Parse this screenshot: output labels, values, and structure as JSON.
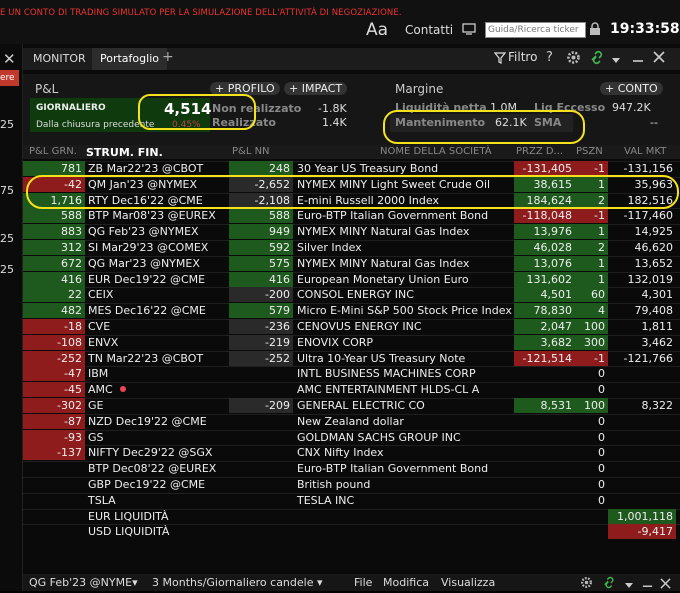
{
  "topbar": {
    "sim_banner": "E UN CONTO DI TRADING SIMULATO PER LA SIMULAZIONE DELL'ATTIVITÀ DI NEGOZIAZIONE.",
    "aa": "Aa",
    "contacts": "Contatti",
    "search_placeholder": "Guida/Ricerca ticker",
    "clock": "19:33:58"
  },
  "left_strip": {
    "close": "✕",
    "ere": "ere",
    "numbers": [
      "25",
      "75",
      "25",
      "25"
    ]
  },
  "tabs": {
    "monitor": "MONITOR",
    "portfolio": "Portafoglio",
    "add": "+",
    "filter": "Filtro",
    "help": "?"
  },
  "pnl": {
    "title": "P&L",
    "btn_profile": "PROFILO",
    "btn_impact": "IMPACT",
    "daily_label": "GIORNALIERO",
    "daily_value": "4,514",
    "since_close_label": "Dalla chiusura precedente",
    "since_close_pct": "0.45%",
    "unrealized_label": "Non realizzato",
    "unrealized_value": "-1.8K",
    "realized_label": "Realizzato",
    "realized_value": "1.4K"
  },
  "margin": {
    "title": "Margine",
    "btn_account": "CONTO",
    "net_liq_label": "Liquidità netta",
    "net_liq_value": "1.0M",
    "excess_label": "Liq Eccesso",
    "excess_value": "947.2K",
    "maint_label": "Mantenimento",
    "maint_value": "62.1K",
    "sma_label": "SMA",
    "sma_value": "--"
  },
  "table": {
    "headers": {
      "pnl_day": "P&L GRN.",
      "instrument": "STRUM. FIN.",
      "pnl_nn": "P&L NN",
      "company": "NOME DELLA SOCIETÀ",
      "avg_price": "PRZZ D...",
      "position": "PSZN",
      "mkt_value": "VAL MKT"
    },
    "rows": [
      {
        "pnl": "781",
        "sym": "ZB Mar22'23 @CBOT",
        "nn": "248",
        "name": "30 Year US Treasury Bond",
        "price": "-131,405",
        "pos": "-1",
        "val": "-131,156",
        "pnlc": "dg",
        "nnc": "dg",
        "pricec": "red",
        "valc": ""
      },
      {
        "pnl": "-42",
        "sym": "QM Jan'23 @NYMEX",
        "nn": "-2,652",
        "name": "NYMEX MINY Light Sweet Crude Oil",
        "price": "38,615",
        "pos": "1",
        "val": "35,963",
        "pnlc": "red",
        "nnc": "gray",
        "pricec": "dg",
        "valc": ""
      },
      {
        "pnl": "1,716",
        "sym": "RTY Dec16'22 @CME",
        "nn": "-2,108",
        "name": "E-mini Russell 2000 Index",
        "price": "184,624",
        "pos": "2",
        "val": "182,516",
        "pnlc": "dg",
        "nnc": "gray",
        "pricec": "dg",
        "valc": ""
      },
      {
        "pnl": "588",
        "sym": "BTP Mar08'23 @EUREX",
        "nn": "588",
        "name": "Euro-BTP Italian Government Bond",
        "price": "-118,048",
        "pos": "-1",
        "val": "-117,460",
        "pnlc": "dg",
        "nnc": "dg",
        "pricec": "red",
        "valc": ""
      },
      {
        "pnl": "883",
        "sym": "QG Feb'23 @NYMEX",
        "nn": "949",
        "name": "NYMEX MINY Natural Gas Index",
        "price": "13,976",
        "pos": "1",
        "val": "14,925",
        "pnlc": "dg",
        "nnc": "dg",
        "pricec": "dg",
        "valc": ""
      },
      {
        "pnl": "312",
        "sym": "SI Mar29'23 @COMEX",
        "nn": "592",
        "name": "Silver Index",
        "price": "46,028",
        "pos": "2",
        "val": "46,620",
        "pnlc": "dg",
        "nnc": "dg",
        "pricec": "dg",
        "valc": ""
      },
      {
        "pnl": "672",
        "sym": "QG Mar'23 @NYMEX",
        "nn": "575",
        "name": "NYMEX MINY Natural Gas Index",
        "price": "13,076",
        "pos": "1",
        "val": "13,652",
        "pnlc": "dg",
        "nnc": "dg",
        "pricec": "dg",
        "valc": ""
      },
      {
        "pnl": "416",
        "sym": "EUR Dec19'22 @CME",
        "nn": "416",
        "name": "European Monetary Union Euro",
        "price": "131,602",
        "pos": "1",
        "val": "132,019",
        "pnlc": "dg",
        "nnc": "dg",
        "pricec": "dg",
        "valc": ""
      },
      {
        "pnl": "22",
        "sym": "CEIX",
        "nn": "-200",
        "name": "CONSOL ENERGY INC",
        "price": "4,501",
        "pos": "60",
        "val": "4,301",
        "pnlc": "dg",
        "nnc": "gray",
        "pricec": "dg",
        "valc": ""
      },
      {
        "pnl": "482",
        "sym": "MES Dec16'22 @CME",
        "nn": "579",
        "name": "Micro E-Mini S&P 500 Stock Price Index",
        "price": "78,830",
        "pos": "4",
        "val": "79,408",
        "pnlc": "dg",
        "nnc": "dg",
        "pricec": "dg",
        "valc": ""
      },
      {
        "pnl": "-18",
        "sym": "CVE",
        "nn": "-236",
        "name": "CENOVUS ENERGY INC",
        "price": "2,047",
        "pos": "100",
        "val": "1,811",
        "pnlc": "red",
        "nnc": "gray",
        "pricec": "dg",
        "valc": ""
      },
      {
        "pnl": "-108",
        "sym": "ENVX",
        "nn": "-219",
        "name": "ENOVIX CORP",
        "price": "3,682",
        "pos": "300",
        "val": "3,462",
        "pnlc": "red",
        "nnc": "gray",
        "pricec": "dg",
        "valc": ""
      },
      {
        "pnl": "-252",
        "sym": "TN Mar22'23 @CBOT",
        "nn": "-252",
        "name": "Ultra 10-Year US Treasury Note",
        "price": "-121,514",
        "pos": "-1",
        "val": "-121,766",
        "pnlc": "red",
        "nnc": "gray",
        "pricec": "red",
        "valc": ""
      },
      {
        "pnl": "-47",
        "sym": "IBM",
        "nn": "",
        "name": "INTL BUSINESS MACHINES CORP",
        "price": "",
        "pos": "0",
        "val": "",
        "pnlc": "red",
        "nnc": "",
        "pricec": "",
        "valc": ""
      },
      {
        "pnl": "-45",
        "sym": "AMC",
        "nn": "",
        "name": "AMC ENTERTAINMENT HLDS-CL A",
        "price": "",
        "pos": "0",
        "val": "",
        "pnlc": "red",
        "nnc": "",
        "pricec": "",
        "valc": "",
        "dot": true
      },
      {
        "pnl": "-302",
        "sym": "GE",
        "nn": "-209",
        "name": "GENERAL ELECTRIC CO",
        "price": "8,531",
        "pos": "100",
        "val": "8,322",
        "pnlc": "red",
        "nnc": "gray",
        "pricec": "dg",
        "valc": ""
      },
      {
        "pnl": "-87",
        "sym": "NZD Dec19'22 @CME",
        "nn": "",
        "name": "New Zealand dollar",
        "price": "",
        "pos": "0",
        "val": "",
        "pnlc": "red",
        "nnc": "",
        "pricec": "",
        "valc": ""
      },
      {
        "pnl": "-93",
        "sym": "GS",
        "nn": "",
        "name": "GOLDMAN SACHS GROUP INC",
        "price": "",
        "pos": "0",
        "val": "",
        "pnlc": "red",
        "nnc": "",
        "pricec": "",
        "valc": ""
      },
      {
        "pnl": "-137",
        "sym": "NIFTY Dec29'22 @SGX",
        "nn": "",
        "name": "CNX Nifty Index",
        "price": "",
        "pos": "0",
        "val": "",
        "pnlc": "red",
        "nnc": "",
        "pricec": "",
        "valc": ""
      },
      {
        "pnl": "",
        "sym": "BTP Dec08'22 @EUREX",
        "nn": "",
        "name": "Euro-BTP Italian Government Bond",
        "price": "",
        "pos": "0",
        "val": "",
        "pnlc": "",
        "nnc": "",
        "pricec": "",
        "valc": ""
      },
      {
        "pnl": "",
        "sym": "GBP Dec19'22 @CME",
        "nn": "",
        "name": "British pound",
        "price": "",
        "pos": "0",
        "val": "",
        "pnlc": "",
        "nnc": "",
        "pricec": "",
        "valc": ""
      },
      {
        "pnl": "",
        "sym": "TSLA",
        "nn": "",
        "name": "TESLA INC",
        "price": "",
        "pos": "0",
        "val": "",
        "pnlc": "",
        "nnc": "",
        "pricec": "",
        "valc": ""
      },
      {
        "pnl": "",
        "sym": "EUR LIQUIDITÀ",
        "nn": "",
        "name": "",
        "price": "",
        "pos": "",
        "val": "1,001,118",
        "pnlc": "",
        "nnc": "",
        "pricec": "",
        "valc": "dg"
      },
      {
        "pnl": "",
        "sym": "USD LIQUIDITÀ",
        "nn": "",
        "name": "",
        "price": "",
        "pos": "",
        "val": "-9,417",
        "pnlc": "",
        "nnc": "",
        "pricec": "",
        "valc": "red"
      }
    ]
  },
  "bottombar": {
    "instrument": "QG Feb'23 @NYME",
    "period": "3 Months/Giornaliero candele",
    "menu_file": "File",
    "menu_edit": "Modifica",
    "menu_view": "Visualizza"
  },
  "colors": {
    "dark_green": "#1e5a1e",
    "red": "#8f1c1c",
    "gray": "#2a2a2a",
    "annotation": "#f6e21a"
  }
}
